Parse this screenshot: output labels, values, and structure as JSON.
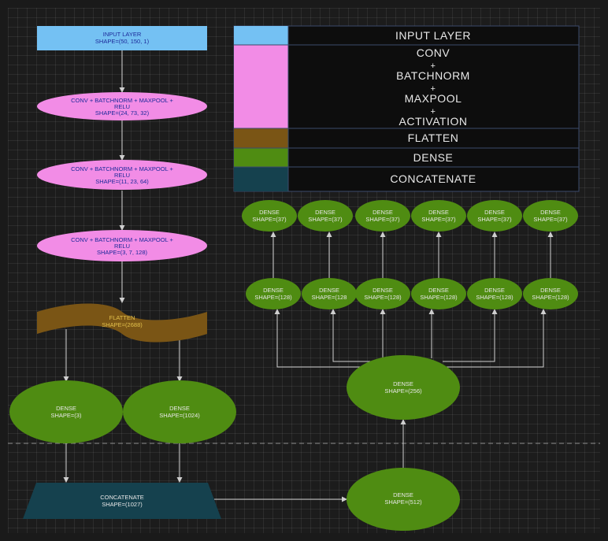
{
  "colors": {
    "input": "#74c1f3",
    "conv": "#f28ce6",
    "flatten": "#7a5515",
    "dense": "#4f8c12",
    "concat": "#15414e",
    "legend_bg": "#0d0d0d",
    "legend_border": "#3b4a6b",
    "text_dark": "#1d2a9a",
    "text_light": "#e8e8e8",
    "flatten_text": "#e2c14c"
  },
  "legend": {
    "input": "INPUT LAYER",
    "conv_lines": [
      "CONV",
      "+",
      "BATCHNORM",
      "+",
      "MAXPOOL",
      "+",
      "ACTIVATION"
    ],
    "flatten": "FLATTEN",
    "dense": "DENSE",
    "concat": "CONCATENATE"
  },
  "left_column": {
    "input": {
      "title": "INPUT LAYER",
      "shape": "SHAPE=(50, 150, 1)"
    },
    "conv_blocks": [
      {
        "title1": "CONV + BATCHNORM + MAXPOOL +",
        "title2": "RELU",
        "shape": "SHAPE=(24, 73, 32)"
      },
      {
        "title1": "CONV + BATCHNORM + MAXPOOL +",
        "title2": "RELU",
        "shape": "SHAPE=(11, 23, 64)"
      },
      {
        "title1": "CONV + BATCHNORM + MAXPOOL +",
        "title2": "RELU",
        "shape": "SHAPE=(3, 7, 128)"
      }
    ],
    "flatten": {
      "title": "FLATTEN",
      "shape": "SHAPE=(2688)"
    },
    "dense_left": {
      "title": "DENSE",
      "shape": "SHAPE=(3)"
    },
    "dense_right": {
      "title": "DENSE",
      "shape": "SHAPE=(1024)"
    },
    "concatenate": {
      "title": "CONCATENATE",
      "shape": "SHAPE=(1027)"
    }
  },
  "right_column": {
    "dense_512": {
      "title": "DENSE",
      "shape": "SHAPE=(512)"
    },
    "dense_256": {
      "title": "DENSE",
      "shape": "SHAPE=(256)"
    },
    "dense_128": [
      {
        "title": "DENSE",
        "shape": "SHAPE=(128)"
      },
      {
        "title": "DENSE",
        "shape": "SHAPE=(128"
      },
      {
        "title": "DENSE",
        "shape": "SHAPE=(128)"
      },
      {
        "title": "DENSE",
        "shape": "SHAPE=(128)"
      },
      {
        "title": "DENSE",
        "shape": "SHAPE=(128)"
      },
      {
        "title": "DENSE",
        "shape": "SHAPE=(128)"
      }
    ],
    "dense_37": [
      {
        "title": "DENSE",
        "shape": "SHAPE=(37)"
      },
      {
        "title": "DENSE",
        "shape": "SHAPE=(37)"
      },
      {
        "title": "DENSE",
        "shape": "SHAPE=(37)"
      },
      {
        "title": "DENSE",
        "shape": "SHAPE=(37)"
      },
      {
        "title": "DENSE",
        "shape": "SHAPE=(37)"
      },
      {
        "title": "DENSE",
        "shape": "SHAPE=(37)"
      }
    ]
  }
}
